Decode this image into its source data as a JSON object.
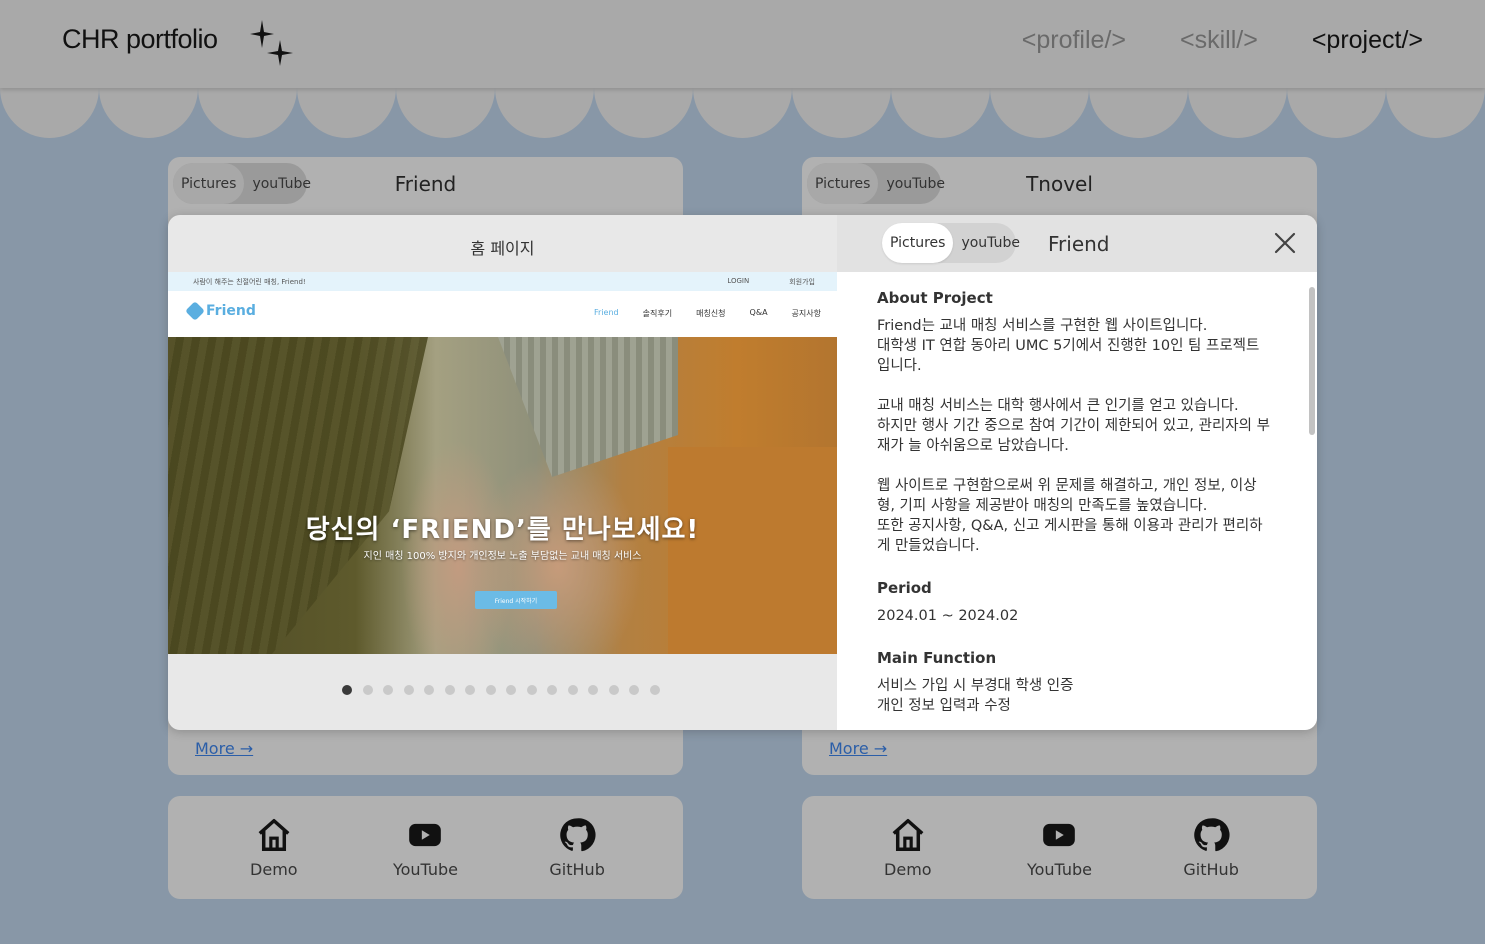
{
  "header": {
    "logo": "CHR portfolio",
    "nav": [
      {
        "label": "<profile/>",
        "active": false
      },
      {
        "label": "<skill/>",
        "active": false
      },
      {
        "label": "<project/>",
        "active": true
      }
    ]
  },
  "cards": [
    {
      "toggle": {
        "pictures": "Pictures",
        "youtube": "youTube"
      },
      "title": "Friend",
      "more": "More →",
      "links": [
        {
          "label": "Demo",
          "icon": "home-icon"
        },
        {
          "label": "YouTube",
          "icon": "youtube-icon"
        },
        {
          "label": "GitHub",
          "icon": "github-icon"
        }
      ]
    },
    {
      "toggle": {
        "pictures": "Pictures",
        "youtube": "youTube"
      },
      "title": "Tnovel",
      "more": "More →",
      "links": [
        {
          "label": "Demo",
          "icon": "home-icon"
        },
        {
          "label": "YouTube",
          "icon": "youtube-icon"
        },
        {
          "label": "GitHub",
          "icon": "github-icon"
        }
      ]
    }
  ],
  "modal": {
    "slide_title": "홈 페이지",
    "slide": {
      "top_bar_left": "사람이 해주는 친절어린 매칭, Friend!",
      "top_bar_right": [
        "LOGIN",
        "회원가입"
      ],
      "logo": "Friend",
      "menu": [
        "Friend",
        "솔직후기",
        "매칭신청",
        "Q&A",
        "공지사항"
      ],
      "headline": "당신의 ‘FRIEND’를 만나보세요!",
      "subline": "지인 매칭 100% 방지와 개인정보 노출 부담없는 교내 매칭 서비스",
      "cta": "Friend 시작하기"
    },
    "dots_total": 16,
    "dots_active_index": 0,
    "toggle": {
      "pictures": "Pictures",
      "youtube": "youTube"
    },
    "title": "Friend",
    "about_heading": "About Project",
    "about_paragraphs": [
      "Friend는 교내 매칭 서비스를 구현한 웹 사이트입니다.\n대학생 IT 연합 동아리 UMC 5기에서 진행한 10인 팀 프로젝트입니다.",
      "교내 매칭 서비스는 대학 행사에서 큰 인기를 얻고 있습니다.\n하지만 행사 기간 중으로 참여 기간이 제한되어 있고, 관리자의 부재가 늘 아쉬움으로 남았습니다.",
      "웹 사이트로 구현함으로써 위 문제를 해결하고, 개인 정보, 이상형, 기피 사항을 제공받아 매칭의 만족도를 높였습니다.\n또한 공지사항, Q&A, 신고 게시판을 통해 이용과 관리가 편리하게 만들었습니다."
    ],
    "period_heading": "Period",
    "period": "2024.01 ~ 2024.02",
    "function_heading": "Main Function",
    "functions": [
      "서비스 가입 시 부경대 학생 인증",
      "개인 정보 입력과 수정"
    ]
  }
}
